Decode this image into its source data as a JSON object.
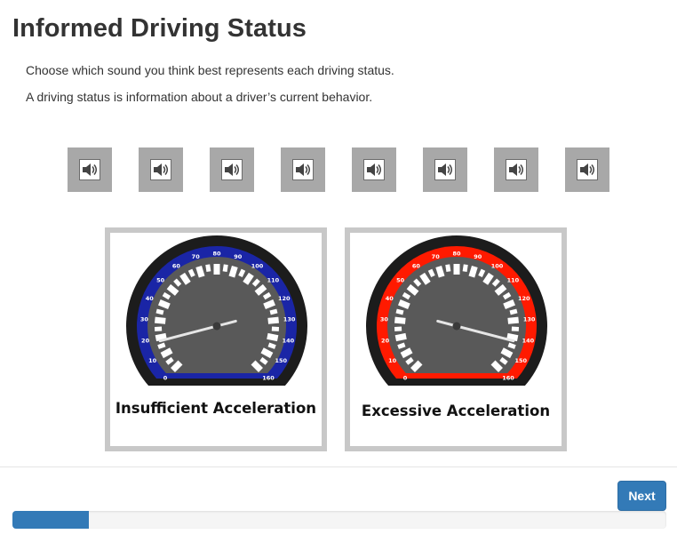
{
  "page": {
    "title": "Informed Driving Status",
    "instructions": [
      "Choose which sound you think best represents each driving status.",
      "A driving status is information about a driver’s current behavior."
    ]
  },
  "sounds": [
    {
      "icon": "speaker-icon"
    },
    {
      "icon": "speaker-icon"
    },
    {
      "icon": "speaker-icon"
    },
    {
      "icon": "speaker-icon"
    },
    {
      "icon": "speaker-icon"
    },
    {
      "icon": "speaker-icon"
    },
    {
      "icon": "speaker-icon"
    },
    {
      "icon": "speaker-icon"
    }
  ],
  "cards": [
    {
      "label": "Insufficient Acceleration",
      "ring_color": "#1a25a6",
      "needle_speed": 18
    },
    {
      "label": "Excessive Acceleration",
      "ring_color": "#ff1a00",
      "needle_speed": 142
    }
  ],
  "gauge": {
    "tick_labels": [
      "0",
      "10",
      "20",
      "30",
      "40",
      "50",
      "60",
      "70",
      "80",
      "90",
      "100",
      "110",
      "120",
      "130",
      "140",
      "150",
      "160"
    ]
  },
  "footer": {
    "next_label": "Next",
    "progress_fraction": 0.117
  },
  "colors": {
    "primary": "#337ab7",
    "sound_button_bg": "#a8a8a8",
    "card_border": "#c8c8c8"
  }
}
